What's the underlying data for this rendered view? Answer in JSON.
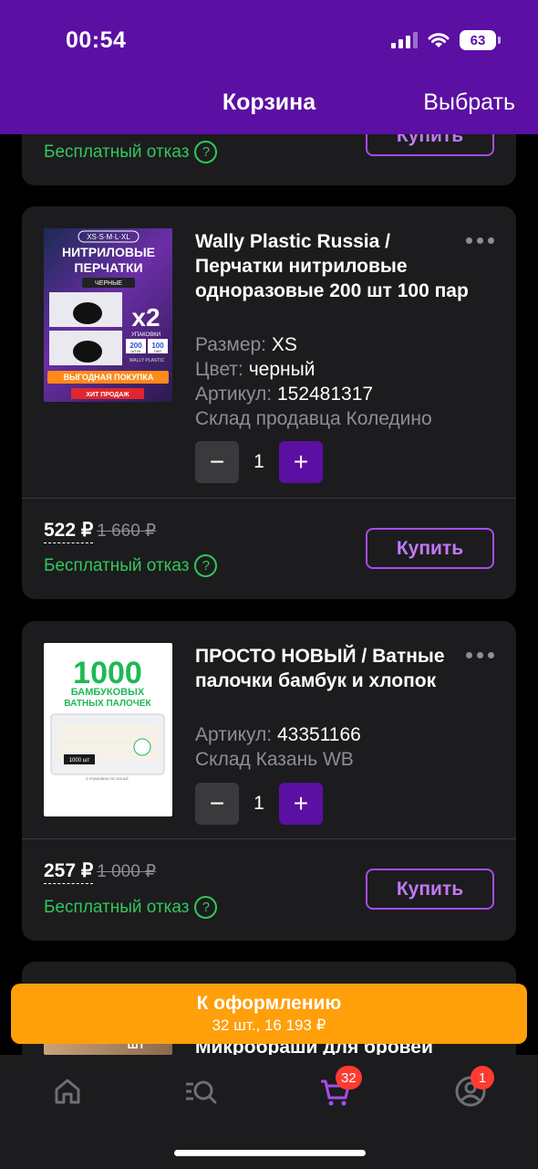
{
  "status": {
    "time": "00:54",
    "battery": "63"
  },
  "header": {
    "title": "Корзина",
    "action": "Выбрать"
  },
  "partial_item": {
    "free_cancel": "Бесплатный отказ",
    "buy": "Купить"
  },
  "items": [
    {
      "name": "Wally Plastic Russia / Перчатки нитриловые одноразовые 200 шт 100 пар",
      "size_label": "Размер:",
      "size": "XS",
      "color_label": "Цвет:",
      "color": "черный",
      "sku_label": "Артикул:",
      "sku": "152481317",
      "warehouse": "Склад продавца Коледино",
      "qty": "1",
      "price": "522 ₽",
      "old_price": "1 660 ₽",
      "free_cancel": "Бесплатный отказ",
      "buy": "Купить",
      "image": {
        "sizes": "XS·S·M·L·XL",
        "line1": "НИТРИЛОВЫЕ",
        "line2": "ПЕРЧАТКИ",
        "color_tag": "ЧЕРНЫЕ",
        "multiplier": "x2",
        "pack": "УПАКОВКИ",
        "pcs": "200",
        "pcs_label": "ШТУК",
        "pairs": "100",
        "pairs_label": "ПАР",
        "brand": "WALLY PLASTIC",
        "promo": "ВЫГОДНАЯ ПОКУПКА",
        "hit": "ХИТ ПРОДАЖ"
      }
    },
    {
      "name": "ПРОСТО НОВЫЙ / Ватные палочки бамбук и хлопок",
      "sku_label": "Артикул:",
      "sku": "43351166",
      "warehouse": "Склад Казань WB",
      "qty": "1",
      "price": "257 ₽",
      "old_price": "1 000 ₽",
      "free_cancel": "Бесплатный отказ",
      "buy": "Купить",
      "image": {
        "big": "1000",
        "line1": "БАМБУКОВЫХ",
        "line2": "ВАТНЫХ ПАЛОЧЕК",
        "pack_label": "1000 шт",
        "footer": "5 УПАКОВОК ПО 200 ШТ."
      }
    }
  ],
  "next_item": {
    "name_partial": "Микробраши для бровей",
    "image_tag": "ШТ"
  },
  "checkout": {
    "label": "К оформлению",
    "summary": "32 шт., 16 193 ₽"
  },
  "tabbar": {
    "cart_badge": "32",
    "profile_badge": "1"
  },
  "colors": {
    "accent": "#5b0fa3",
    "checkout": "#ff9f0a",
    "green": "#30c85a",
    "card": "#1c1c1e"
  }
}
